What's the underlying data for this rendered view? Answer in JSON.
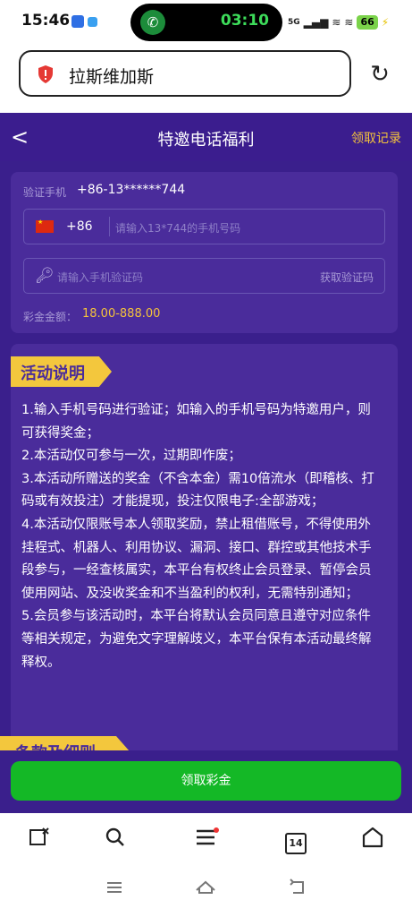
{
  "status_bar": {
    "time": "15:46",
    "call_timer": "03:10",
    "network": "5G",
    "battery": "66"
  },
  "browser": {
    "url_text": "拉斯维加斯",
    "reload_icon": "reload-icon",
    "security_icon": "shield-alert-icon"
  },
  "header": {
    "back_label": "<",
    "title": "特邀电话福利",
    "records_link": "领取记录"
  },
  "form": {
    "verify_label": "验证手机",
    "verify_phone": "+86-13******744",
    "country_code": "+86",
    "phone_placeholder": "请输入13*744的手机号码",
    "code_placeholder": "请输入手机验证码",
    "get_code_label": "获取验证码",
    "bonus_label": "彩金金额：",
    "bonus_range": "18.00-888.00"
  },
  "activity": {
    "heading": "活动说明",
    "rules": [
      "1.输入手机号码进行验证；如输入的手机号码为特邀用户，则可获得奖金；",
      "2.本活动仅可参与一次，过期即作废；",
      "3.本活动所赠送的奖金（不含本金）需10倍流水（即稽核、打码或有效投注）才能提现，投注仅限电子:全部游戏；",
      "4.本活动仅限账号本人领取奖励，禁止租借账号，不得使用外挂程式、机器人、利用协议、漏洞、接口、群控或其他技术手段参与，一经查核属实，本平台有权终止会员登录、暂停会员使用网站、及没收奖金和不当盈利的权利，无需特别通知；",
      "5.会员参与该活动时，本平台将默认会员同意且遵守对应条件等相关规定，为避免文字理解歧义，本平台保有本活动最终解释权。"
    ],
    "terms_heading": "条款及细则"
  },
  "claim_button": "领取彩金",
  "toolbar": {
    "tab_count": "14"
  },
  "colors": {
    "page_bg": "#3a1f8c",
    "card_bg": "#4a2c9b",
    "accent_gold": "#f3c73d",
    "button_green": "#14b826"
  }
}
